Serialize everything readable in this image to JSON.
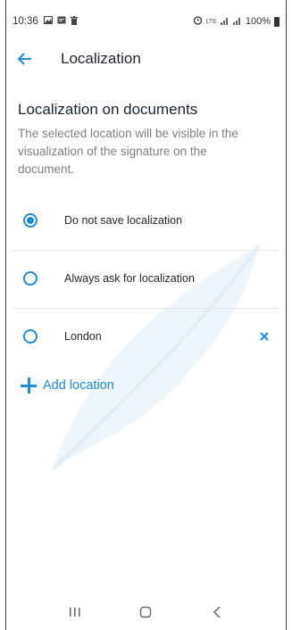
{
  "status_bar": {
    "time": "10:36",
    "battery": "100%",
    "icons_left": [
      "gallery-icon",
      "message-icon",
      "trash-icon"
    ],
    "icons_right": [
      "alarm-icon",
      "lte-icon",
      "signal-icon",
      "signal-icon",
      "battery-icon"
    ]
  },
  "header": {
    "title": "Localization",
    "back_icon": "back-arrow-icon"
  },
  "section": {
    "title": "Localization on documents",
    "description": "The selected location will be visible in the visualization of the signature on the document."
  },
  "options": [
    {
      "label": "Do not save localization",
      "selected": true
    },
    {
      "label": "Always ask for localization",
      "selected": false
    },
    {
      "label": "London",
      "selected": false,
      "removable": true
    }
  ],
  "add_location": {
    "label": "Add location",
    "icon": "plus-icon"
  },
  "colors": {
    "accent": "#1f8cd7",
    "text": "#1d2430",
    "muted_text": "#7b8088",
    "divider": "#e3e6ea"
  },
  "nav_bar": {
    "icons": [
      "recent-apps-icon",
      "home-icon",
      "back-icon"
    ]
  }
}
